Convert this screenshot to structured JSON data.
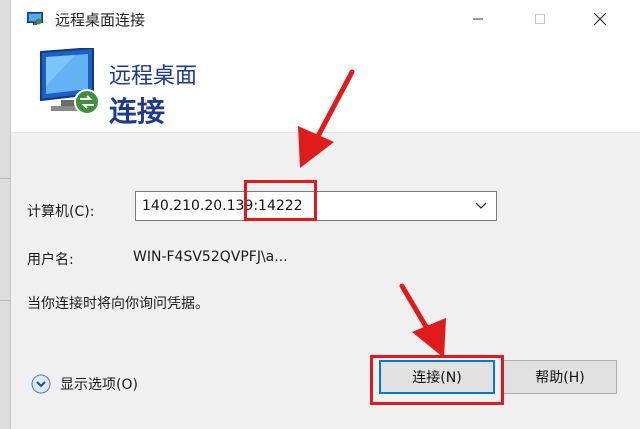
{
  "window": {
    "title": "远程桌面连接",
    "title_icon": "remote-desktop-icon",
    "controls": [
      "minimize-icon",
      "maximize-icon",
      "close-icon"
    ]
  },
  "header": {
    "subtitle": "远程桌面",
    "title": "连接",
    "icon": "monitor-icon"
  },
  "form": {
    "computer_label": "计算机(C):",
    "computer_value": "140.210.20.139:14222",
    "user_label": "用户名:",
    "user_value": "WIN-F4SV52QVPFJ\\a...",
    "notice": "当你连接时将向你询问凭据。"
  },
  "footer": {
    "options_label": "显示选项(O)",
    "connect_label": "连接(N)",
    "help_label": "帮助(H)"
  },
  "colors": {
    "accent": "#0078d7",
    "header_text": "#1e3a8a",
    "annotation": "#e01b1b",
    "body_bg": "#f0f0f0"
  }
}
